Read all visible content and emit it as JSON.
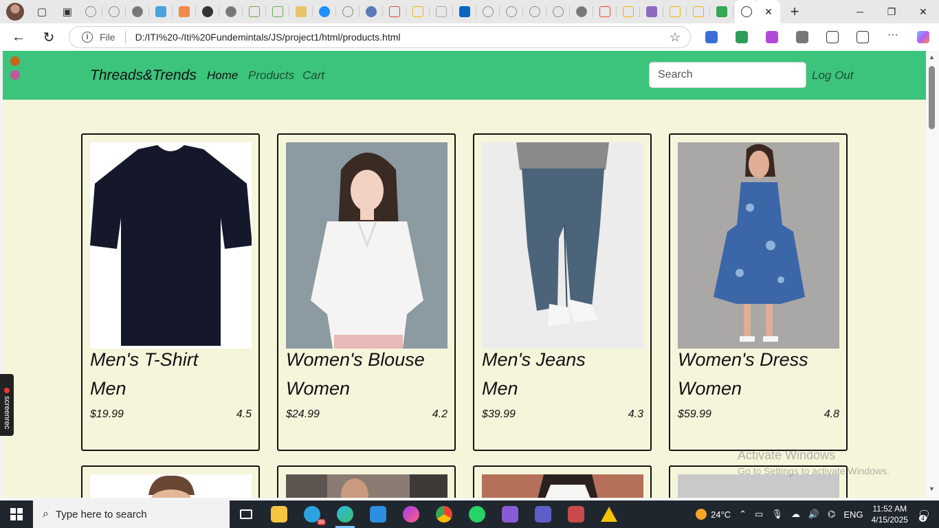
{
  "browser": {
    "address_scheme_label": "File",
    "url": "D:/ITI%20-/Iti%20Fundemintals/JS/project1/html/products.html"
  },
  "page": {
    "brand": "Threads&Trends",
    "nav": {
      "home": "Home",
      "products": "Products",
      "cart": "Cart"
    },
    "search_placeholder": "Search",
    "logout": "Log Out",
    "products": [
      {
        "name": "Men's T-Shirt",
        "category": "Men",
        "price": "$19.99",
        "rating": "4.5"
      },
      {
        "name": "Women's Blouse",
        "category": "Women",
        "price": "$24.99",
        "rating": "4.2"
      },
      {
        "name": "Men's Jeans",
        "category": "Men",
        "price": "$39.99",
        "rating": "4.3"
      },
      {
        "name": "Women's Dress",
        "category": "Women",
        "price": "$59.99",
        "rating": "4.8"
      }
    ],
    "colors": {
      "navbar": "#3cc47c",
      "background": "#f5f5dc",
      "active_link": "#111111",
      "inactive_link": "#1e4d33"
    }
  },
  "overlays": {
    "activate_title": "Activate Windows",
    "activate_sub": "Go to Settings to activate Windows.",
    "screenrec_label": "screenrec"
  },
  "taskbar": {
    "search_placeholder": "Type here to search",
    "weather": "24°C",
    "language": "ENG",
    "time": "11:52 AM",
    "date": "4/15/2025",
    "notification_count": "4",
    "telegram_badge": "86"
  }
}
